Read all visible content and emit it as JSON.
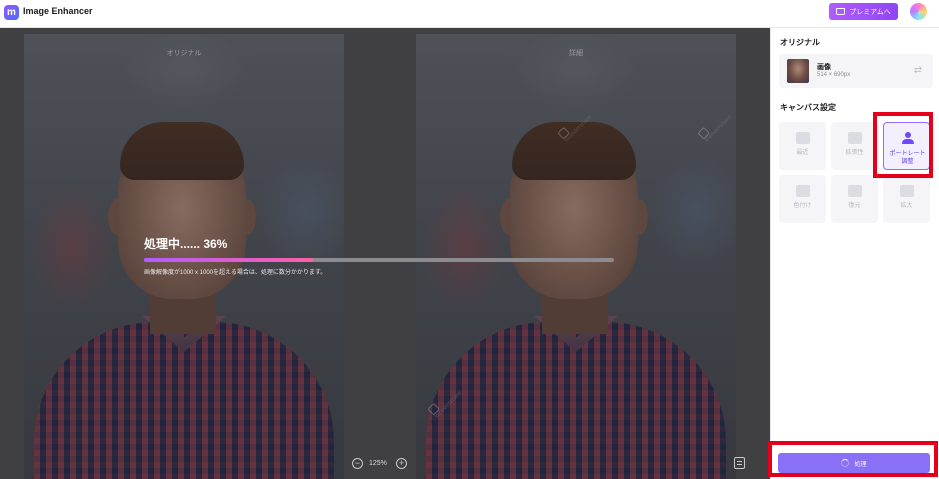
{
  "app": {
    "title": "Image Enhancer",
    "logo_glyph": "m"
  },
  "topbar": {
    "premium_label": "プレミアムへ"
  },
  "canvas": {
    "left_label": "オリジナル",
    "right_label": "詳細",
    "watermark": "Wondershare",
    "zoom_level": "125%"
  },
  "progress": {
    "title": "処理中...... 36%",
    "percent": 36,
    "note": "画像解像度が1000 x 1000を超える場合は、処理に数分かかります。"
  },
  "sidebar": {
    "original_section_title": "オリジナル",
    "original_file_name": "画像",
    "original_file_size": "514 × 690px",
    "canvas_section_title": "キャンバス設定",
    "tiles": [
      {
        "label": "最近",
        "icon": "image-icon",
        "active": false
      },
      {
        "label": "拡張性",
        "icon": "image-icon",
        "active": false
      },
      {
        "label": "ポートレート\n調整",
        "icon": "person-icon",
        "active": true
      },
      {
        "label": "色付け",
        "icon": "color-icon",
        "active": false
      },
      {
        "label": "復元",
        "icon": "restore-icon",
        "active": false
      },
      {
        "label": "拡大",
        "icon": "upscale-icon",
        "active": false
      }
    ],
    "process_button_label": "処理"
  },
  "colors": {
    "accent": "#8a70f6",
    "premium": "#a552ff",
    "highlight": "#e4001b",
    "progress_start": "#b35cff",
    "progress_end": "#ff5fa8"
  }
}
